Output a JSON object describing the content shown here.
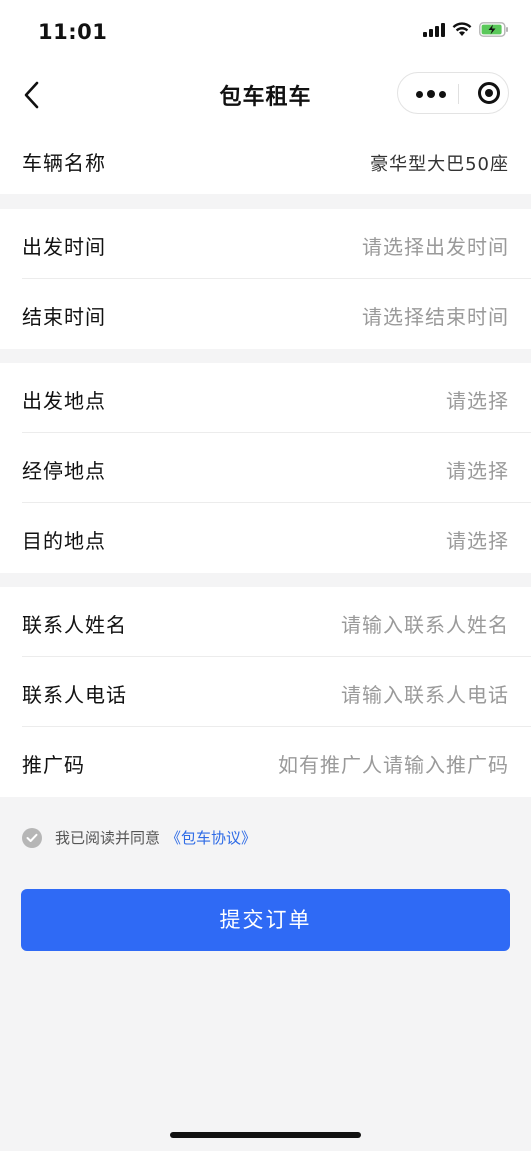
{
  "status_bar": {
    "time": "11:01",
    "icons": [
      "signal-icon",
      "wifi-icon",
      "battery-charging-icon"
    ]
  },
  "nav": {
    "title": "包车租车",
    "back_icon": "chevron-left-icon",
    "capsule_icons": [
      "more-icon",
      "close-target-icon"
    ]
  },
  "form": {
    "vehicle": {
      "label": "车辆名称",
      "value": "豪华型大巴50座"
    },
    "depart_time": {
      "label": "出发时间",
      "placeholder": "请选择出发时间"
    },
    "end_time": {
      "label": "结束时间",
      "placeholder": "请选择结束时间"
    },
    "depart_place": {
      "label": "出发地点",
      "placeholder": "请选择"
    },
    "stop_place": {
      "label": "经停地点",
      "placeholder": "请选择"
    },
    "dest_place": {
      "label": "目的地点",
      "placeholder": "请选择"
    },
    "contact_name": {
      "label": "联系人姓名",
      "placeholder": "请输入联系人姓名"
    },
    "contact_phone": {
      "label": "联系人电话",
      "placeholder": "请输入联系人电话"
    },
    "promo_code": {
      "label": "推广码",
      "placeholder": "如有推广人请输入推广码"
    }
  },
  "agreement": {
    "text": "我已阅读并同意",
    "link": "《包车协议》"
  },
  "submit_label": "提交订单",
  "colors": {
    "accent": "#2f6af5",
    "link": "#2e6be6",
    "page_bg": "#f4f4f5",
    "placeholder": "#9a9a9a"
  }
}
